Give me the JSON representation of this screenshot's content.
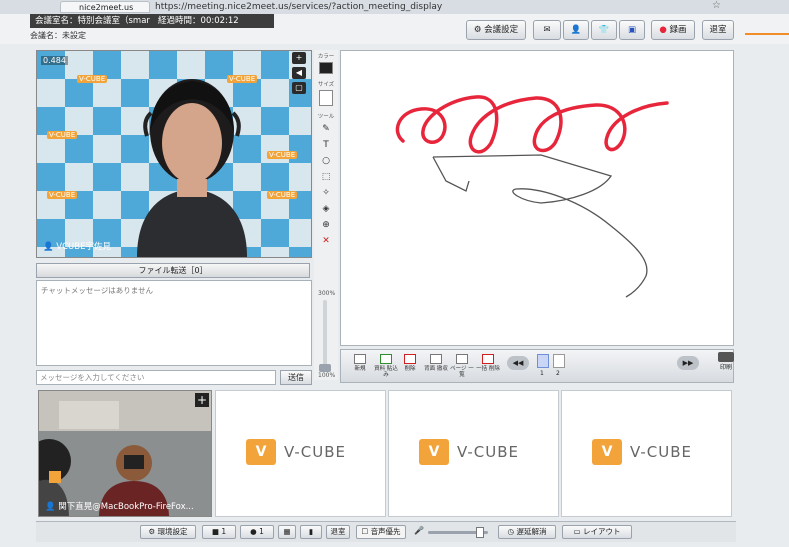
{
  "browser": {
    "tab_label": "nice2meet.us",
    "url": "https://meeting.nice2meet.us/services/?action_meeting_display"
  },
  "header": {
    "room_line": "会議室名：特別会議室（smar",
    "elapsed_label": "経過時間：00:02:12",
    "meeting_name": "会議名：未設定",
    "settings_button": "会議設定",
    "record_button": "録画",
    "exit_button": "退室"
  },
  "video_main": {
    "fps": "0.484",
    "participant": "VCUBE宇佐見",
    "logo_text": "V-CUBE"
  },
  "side_panel": {
    "color_label": "カラー",
    "size_label": "サイズ",
    "tool_label": "ツール",
    "zoom_pct_top": "300%",
    "zoom_pct_bottom": "100%"
  },
  "file_transfer": "ファイル転送［0］",
  "chat": {
    "empty_message": "チャットメッセージはありません",
    "input_placeholder": "メッセージを入力してください",
    "send_button": "送信"
  },
  "board_toolbar": [
    {
      "label": "新規"
    },
    {
      "label": "資料\n貼込み"
    },
    {
      "label": "削除"
    },
    {
      "label": "背面\n撤収"
    },
    {
      "label": "ページ\n一覧"
    },
    {
      "label": "一括\n削除"
    }
  ],
  "pages": [
    "1",
    "2"
  ],
  "print_label": "印刷",
  "video_second": {
    "participant": "関下直晃@MacBookPro-FireFox..."
  },
  "placeholder_logo": "V-CUBE",
  "bottom_bar": {
    "env_settings": "環境設定",
    "cam": "1",
    "mic": "1",
    "exit_room": "退室",
    "audio_priority": "音声優先",
    "delay": "遅延解消",
    "layout": "レイアウト"
  },
  "colors": {
    "accent_orange": "#f2a43b",
    "ink_red": "#e8263b",
    "ink_gray": "#555555"
  }
}
